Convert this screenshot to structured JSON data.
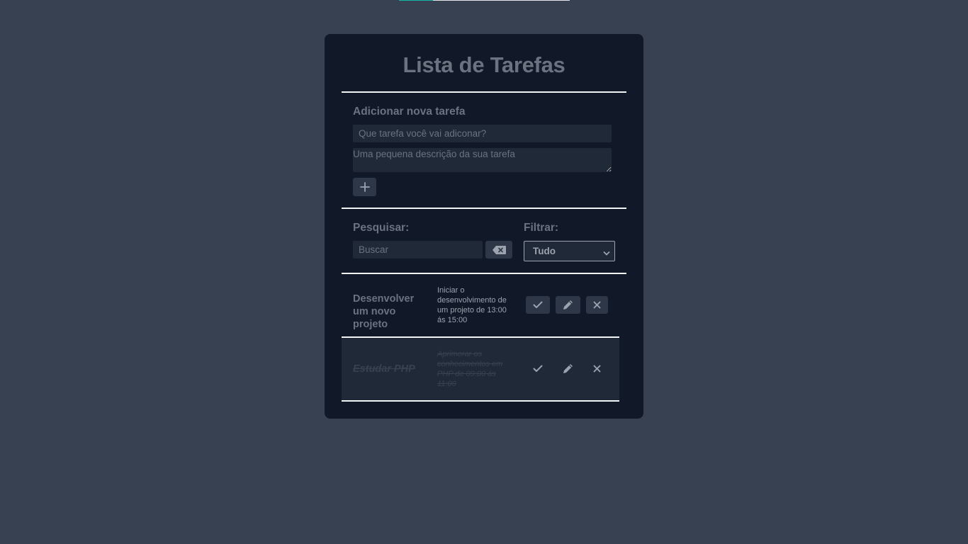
{
  "progress": {
    "value": 0.2
  },
  "app": {
    "title": "Lista de Tarefas"
  },
  "add_form": {
    "heading": "Adicionar nova tarefa",
    "title_placeholder": "Que tarefa você vai adiconar?",
    "description_placeholder": "Uma pequena descrição da sua tarefa",
    "add_icon": "plus-icon"
  },
  "toolbar": {
    "search_label": "Pesquisar:",
    "search_placeholder": "Buscar",
    "clear_icon": "backspace-icon",
    "filter_label": "Filtrar:",
    "filter_selected": "Tudo"
  },
  "todos": [
    {
      "title": "Desenvolver um novo projeto",
      "description": "Iniciar o desenvolvimento de um projeto de 13:00 ás 15:00",
      "done": false
    },
    {
      "title": "Estudar PHP",
      "description": "Aprimorar os conhecimentos em PHP de 09:00 ás 11:00",
      "done": true
    }
  ],
  "colors": {
    "background": "#374151",
    "card": "#111827",
    "field": "#1f2937",
    "accent": "#14b8a6"
  }
}
